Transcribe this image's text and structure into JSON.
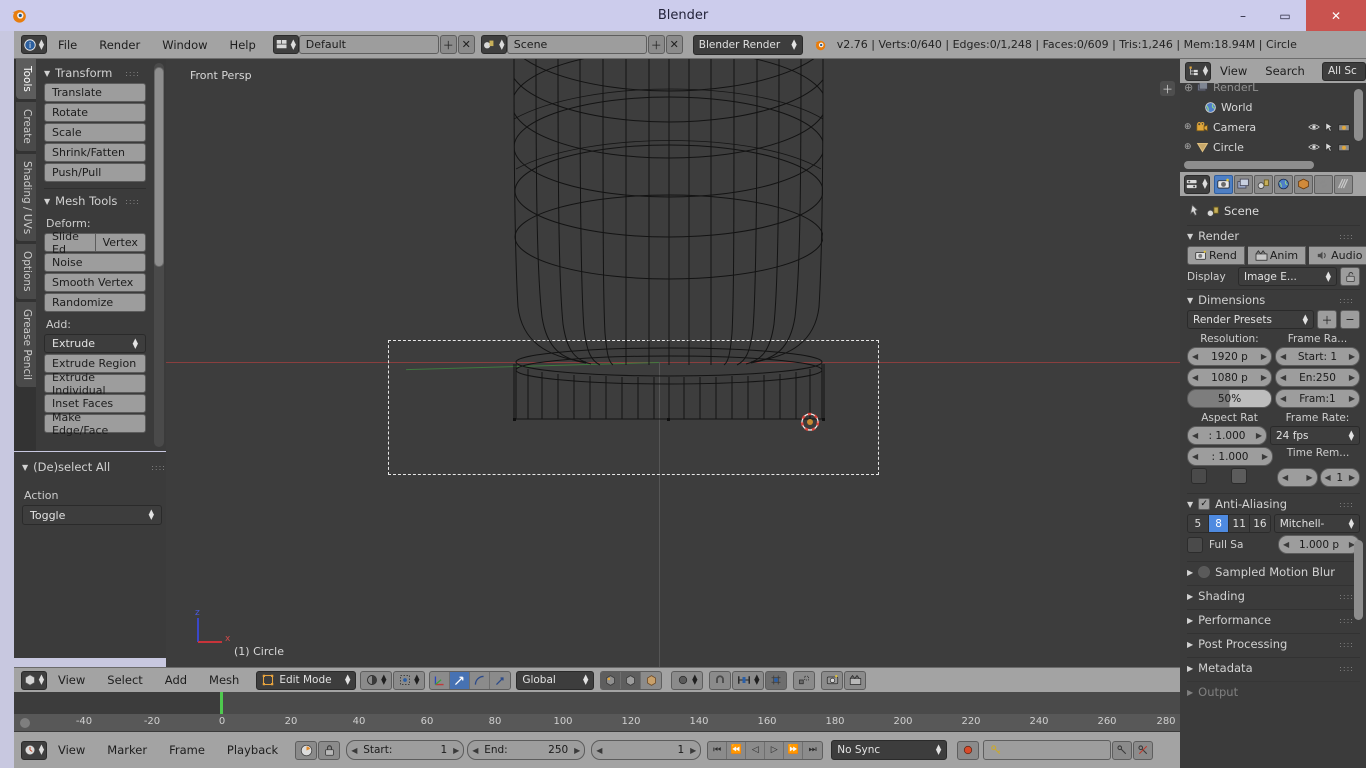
{
  "window": {
    "title": "Blender",
    "app_icon": "blender-logo-icon",
    "minimize": "–",
    "maximize": "▭",
    "close": "✕"
  },
  "infobar": {
    "editor_type_icon": "info-editor-icon",
    "menus": [
      "File",
      "Render",
      "Window",
      "Help"
    ],
    "screen_layout_icon": "screen-layout-icon",
    "screen_layout": "Default",
    "add_layout": "＋",
    "del_layout": "✕",
    "scene_icon": "scene-icon",
    "scene": "Scene",
    "add_scene": "＋",
    "del_scene": "✕",
    "engine": "Blender Render",
    "stats_icon": "blender-logo-icon",
    "stats": "v2.76 | Verts:0/640 | Edges:0/1,248 | Faces:0/609 | Tris:1,246 | Mem:18.94M | Circle"
  },
  "toolshelf": {
    "tabs": [
      {
        "label": "Tools",
        "active": true
      },
      {
        "label": "Create",
        "active": false
      },
      {
        "label": "Shading / UVs",
        "active": false
      },
      {
        "label": "Options",
        "active": false
      },
      {
        "label": "Grease Pencil",
        "active": false
      }
    ],
    "transform": {
      "title": "Transform",
      "buttons": [
        "Translate",
        "Rotate",
        "Scale",
        "Shrink/Fatten",
        "Push/Pull"
      ]
    },
    "mesh_tools": {
      "title": "Mesh Tools",
      "deform_label": "Deform:",
      "deform_pair": [
        "Slide Ed",
        "Vertex"
      ],
      "deform_buttons": [
        "Noise",
        "Smooth Vertex",
        "Randomize"
      ],
      "add_label": "Add:",
      "add_selected": "Extrude",
      "add_buttons": [
        "Extrude Region",
        "Extrude Individual",
        "Inset Faces",
        "Make Edge/Face"
      ]
    }
  },
  "operator_panel": {
    "title": "(De)select All",
    "action_label": "Action",
    "action_value": "Toggle"
  },
  "viewport": {
    "view_name": "Front Persp",
    "object_info": "(1) Circle",
    "axis_z": "z",
    "axis_x": "x",
    "expand_button": "＋",
    "colors": {
      "background": "#3d3d3d",
      "x_axis_line": "#a33a3a",
      "y_axis_line": "#3f8a3f",
      "wire": "#121212",
      "camera_frame": "#e8e8e8",
      "cursor_ring": "#d8453c"
    }
  },
  "viewport_header": {
    "editor_type_icon": "3d-view-editor-icon",
    "menus": [
      "View",
      "Select",
      "Add",
      "Mesh"
    ],
    "mode_icon": "edit-mode-icon",
    "mode": "Edit Mode",
    "shading_icon": "solid-shading-icon",
    "pivot_icon": "pivot-median-icon",
    "select_modes": [
      "vertex-select-icon",
      "edge-select-icon",
      "face-select-icon"
    ],
    "manipulator_icons": [
      "transform-manipulator-icon",
      "translate-manipulator-icon",
      "rotate-manipulator-icon",
      "scale-manipulator-icon"
    ],
    "orientation": "Global",
    "layer_icons": [
      "limit-to-visible-icon",
      "occlude-geometry-icon",
      "xray-icon"
    ],
    "proportional_icon": "proportional-edit-icon",
    "snap_icon": "snap-magnet-icon",
    "snap_target_icon": "snap-element-icon",
    "snap_mode_icon": "snap-closest-icon",
    "pivot_center_icon": "pivot-center-icon",
    "render_icons": [
      "render-image-icon",
      "render-animation-icon"
    ]
  },
  "timeline": {
    "ticks": [
      "-40",
      "-20",
      "0",
      "20",
      "40",
      "60",
      "80",
      "100",
      "120",
      "140",
      "160",
      "180",
      "200",
      "220",
      "240",
      "260",
      "280"
    ],
    "current_frame_marker": 0,
    "editor_type_icon": "timeline-editor-icon",
    "menus": [
      "View",
      "Marker",
      "Frame",
      "Playback"
    ],
    "autokey_icon": "record-autokey-icon",
    "lock_icon": "lock-icon",
    "start_label": "Start:",
    "start_value": "1",
    "end_label": "End:",
    "end_value": "250",
    "current_frame": "1",
    "transport": [
      "⏮",
      "⏪",
      "◁",
      "▷",
      "⏩",
      "⏭"
    ],
    "sync_mode": "No Sync",
    "record_icon": "record-icon",
    "keyingset_icon": "keyingset-icon",
    "keyingset_value": "",
    "insert_key_icon": "insert-keyframe-icon",
    "delete_key_icon": "delete-keyframe-icon"
  },
  "outliner": {
    "editor_type_icon": "outliner-editor-icon",
    "menus": [
      "View",
      "Search"
    ],
    "display_mode": "All Sc",
    "rows": [
      {
        "icon": "renderlayers-icon",
        "label": "RenderL",
        "indent": 12,
        "expander": "⊕",
        "show_cols": false
      },
      {
        "icon": "world-icon",
        "label": "World",
        "indent": 20,
        "expander": "",
        "show_cols": false
      },
      {
        "icon": "camera-icon",
        "label": "Camera",
        "indent": 8,
        "expander": "⊕",
        "show_cols": true
      },
      {
        "icon": "mesh-icon",
        "label": "Circle",
        "indent": 8,
        "expander": "⊕",
        "show_cols": true
      }
    ],
    "col_icons": [
      "eye-icon",
      "cursor-arrow-icon",
      "camera-restrict-icon"
    ]
  },
  "properties": {
    "editor_type_icon": "properties-editor-icon",
    "tabs": [
      {
        "icon": "render-tab-icon",
        "selected": true
      },
      {
        "icon": "render-layers-tab-icon",
        "selected": false
      },
      {
        "icon": "scene-tab-icon",
        "selected": false
      },
      {
        "icon": "world-tab-icon",
        "selected": false
      },
      {
        "icon": "object-tab-icon",
        "selected": false
      },
      {
        "icon": "constraints-tab-icon",
        "selected": false
      },
      {
        "icon": "modifiers-tab-icon",
        "selected": false
      }
    ],
    "breadcrumb_pin_icon": "pin-icon",
    "breadcrumb_icon": "scene-icon",
    "breadcrumb": "Scene",
    "render": {
      "title": "Render",
      "render_button": "Rend",
      "anim_button": "Anim",
      "audio_button": "Audio",
      "display_label": "Display",
      "display_value": "Image E...",
      "display_lock_icon": "lock-display-icon"
    },
    "dimensions": {
      "title": "Dimensions",
      "presets_label": "Render Presets",
      "preset_add": "＋",
      "preset_del": "−",
      "resolution_label": "Resolution:",
      "resolution_x": "1920 p",
      "resolution_y": "1080 p",
      "resolution_percent": "50%",
      "frame_range_label": "Frame Ra...",
      "frame_start": "Start: 1",
      "frame_end": "En:250",
      "frame_step": "Fram:1",
      "aspect_label": "Aspect Rat",
      "aspect_x": ": 1.000",
      "aspect_y": ": 1.000",
      "framerate_label": "Frame Rate:",
      "framerate": "24 fps",
      "time_remap_label": "Time Rem...",
      "time_remap_old": "",
      "time_remap_new": "1",
      "border_toggle": "",
      "crop_toggle": ""
    },
    "anti_aliasing": {
      "title": "Anti-Aliasing",
      "enabled": true,
      "samples": [
        "5",
        "8",
        "11",
        "16"
      ],
      "selected_sample": "8",
      "filter": "Mitchell-",
      "full_sample_label": "Full Sa",
      "filter_size": "1.000 p"
    },
    "collapsed_sections": [
      {
        "title": "Sampled Motion Blur",
        "checkbox": true
      },
      {
        "title": "Shading",
        "checkbox": false
      },
      {
        "title": "Performance",
        "checkbox": false
      },
      {
        "title": "Post Processing",
        "checkbox": false
      },
      {
        "title": "Metadata",
        "checkbox": false
      },
      {
        "title": "Output",
        "checkbox": false
      }
    ]
  }
}
